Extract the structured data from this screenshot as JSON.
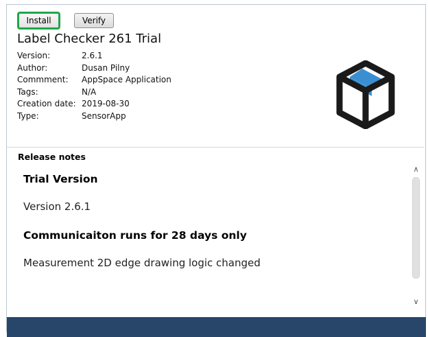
{
  "toolbar": {
    "install_label": "Install",
    "verify_label": "Verify"
  },
  "app": {
    "title": "Label Checker 261 Trial",
    "details": [
      {
        "label": "Version:",
        "value": "2.6.1"
      },
      {
        "label": "Author:",
        "value": "Dusan Pilny"
      },
      {
        "label": "Commment:",
        "value": "AppSpace Application"
      },
      {
        "label": "Tags:",
        "value": "N/A"
      },
      {
        "label": "Creation date:",
        "value": "2019-08-30"
      },
      {
        "label": "Type:",
        "value": "SensorApp"
      }
    ],
    "logo_icon": "package-box-icon"
  },
  "release_notes": {
    "header": "Release notes",
    "heading": "Trial Version",
    "version_line": "Version 2.6.1",
    "bold_line": "Communicaiton runs for 28 days only",
    "change_line": "Measurement 2D edge drawing logic changed"
  },
  "colors": {
    "install_highlight": "#1fa64a",
    "logo_dark": "#1a1a1a",
    "logo_accent": "#3b8fd1",
    "bottom_bar": "#27466a"
  }
}
